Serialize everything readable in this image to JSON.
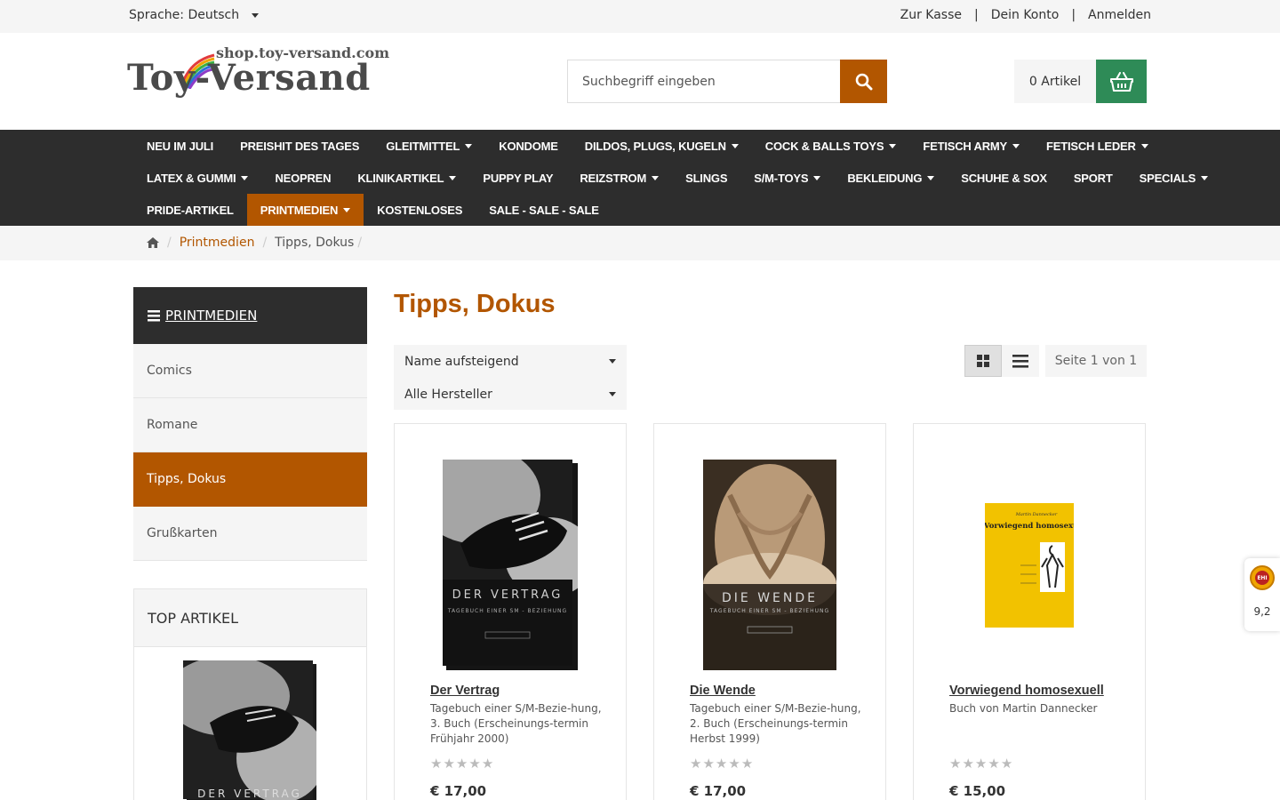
{
  "topbar": {
    "language": "Sprache: Deutsch",
    "links": [
      "Zur Kasse",
      "Dein Konto",
      "Anmelden"
    ],
    "separator": "|"
  },
  "logo": {
    "url_text": "shop.toy-versand.com",
    "name": "Toy-Versand"
  },
  "search": {
    "placeholder": "Suchbegriff eingeben"
  },
  "cart": {
    "count_label": "0 Artikel"
  },
  "nav": {
    "rows": [
      [
        {
          "label": "NEU IM JULI",
          "dropdown": false
        },
        {
          "label": "PREISHIT DES TAGES",
          "dropdown": false
        },
        {
          "label": "GLEITMITTEL",
          "dropdown": true
        },
        {
          "label": "KONDOME",
          "dropdown": false
        },
        {
          "label": "DILDOS, PLUGS, KUGELN",
          "dropdown": true
        },
        {
          "label": "COCK & BALLS TOYS",
          "dropdown": true
        },
        {
          "label": "FETISCH ARMY",
          "dropdown": true
        },
        {
          "label": "FETISCH LEDER",
          "dropdown": true
        }
      ],
      [
        {
          "label": "LATEX & GUMMI",
          "dropdown": true
        },
        {
          "label": "NEOPREN",
          "dropdown": false
        },
        {
          "label": "KLINIKARTIKEL",
          "dropdown": true
        },
        {
          "label": "PUPPY PLAY",
          "dropdown": false
        },
        {
          "label": "REIZSTROM",
          "dropdown": true
        },
        {
          "label": "SLINGS",
          "dropdown": false
        },
        {
          "label": "S/M-TOYS",
          "dropdown": true
        },
        {
          "label": "BEKLEIDUNG",
          "dropdown": true
        },
        {
          "label": "SCHUHE & SOX",
          "dropdown": false
        },
        {
          "label": "SPORT",
          "dropdown": false
        },
        {
          "label": "SPECIALS",
          "dropdown": true
        }
      ],
      [
        {
          "label": "PRIDE-ARTIKEL",
          "dropdown": false
        },
        {
          "label": "PRINTMEDIEN",
          "dropdown": true,
          "active": true
        },
        {
          "label": "KOSTENLOSES",
          "dropdown": false
        },
        {
          "label": "SALE - SALE - SALE",
          "dropdown": false
        }
      ]
    ]
  },
  "breadcrumb": {
    "items": [
      "Printmedien",
      "Tipps, Dokus"
    ],
    "separator": "/"
  },
  "sidebar": {
    "heading": "PRINTMEDIEN",
    "items": [
      {
        "label": "Comics",
        "active": false
      },
      {
        "label": "Romane",
        "active": false
      },
      {
        "label": "Tipps, Dokus",
        "active": true
      },
      {
        "label": "Grußkarten",
        "active": false
      }
    ],
    "top_articles_heading": "TOP ARTIKEL"
  },
  "main": {
    "title": "Tipps, Dokus",
    "sort_select": "Name aufsteigend",
    "manufacturer_select": "Alle Hersteller",
    "page_info": "Seite 1 von 1"
  },
  "products": [
    {
      "name": "Der Vertrag",
      "description": "Tagebuch einer S/M-Bezie-hung, 3. Buch (Erscheinungs-termin Frühjahr 2000)",
      "price": "€ 17,00",
      "rating": 0,
      "cover_title": "DER VERTRAG",
      "cover_subtitle": "TAGEBUCH EINER SM - BEZIEHUNG"
    },
    {
      "name": "Die Wende",
      "description": "Tagebuch einer S/M-Bezie-hung, 2. Buch (Erscheinungs-termin Herbst 1999)",
      "price": "€ 17,00",
      "rating": 0,
      "cover_title": "DIE WENDE",
      "cover_subtitle": "TAGEBUCH EINER SM - BEZIEHUNG"
    },
    {
      "name": "Vorwiegend homosexuell",
      "description": "Buch von Martin Dannecker",
      "price": "€ 15,00",
      "rating": 0,
      "cover_author": "Martin Dannecker",
      "cover_title": "Vorwiegend homosexuell"
    }
  ],
  "trust_badge": {
    "score": "9,2"
  },
  "colors": {
    "accent": "#b25600",
    "nav_bg": "#2d2d2d",
    "cart_green": "#2e8b57"
  }
}
